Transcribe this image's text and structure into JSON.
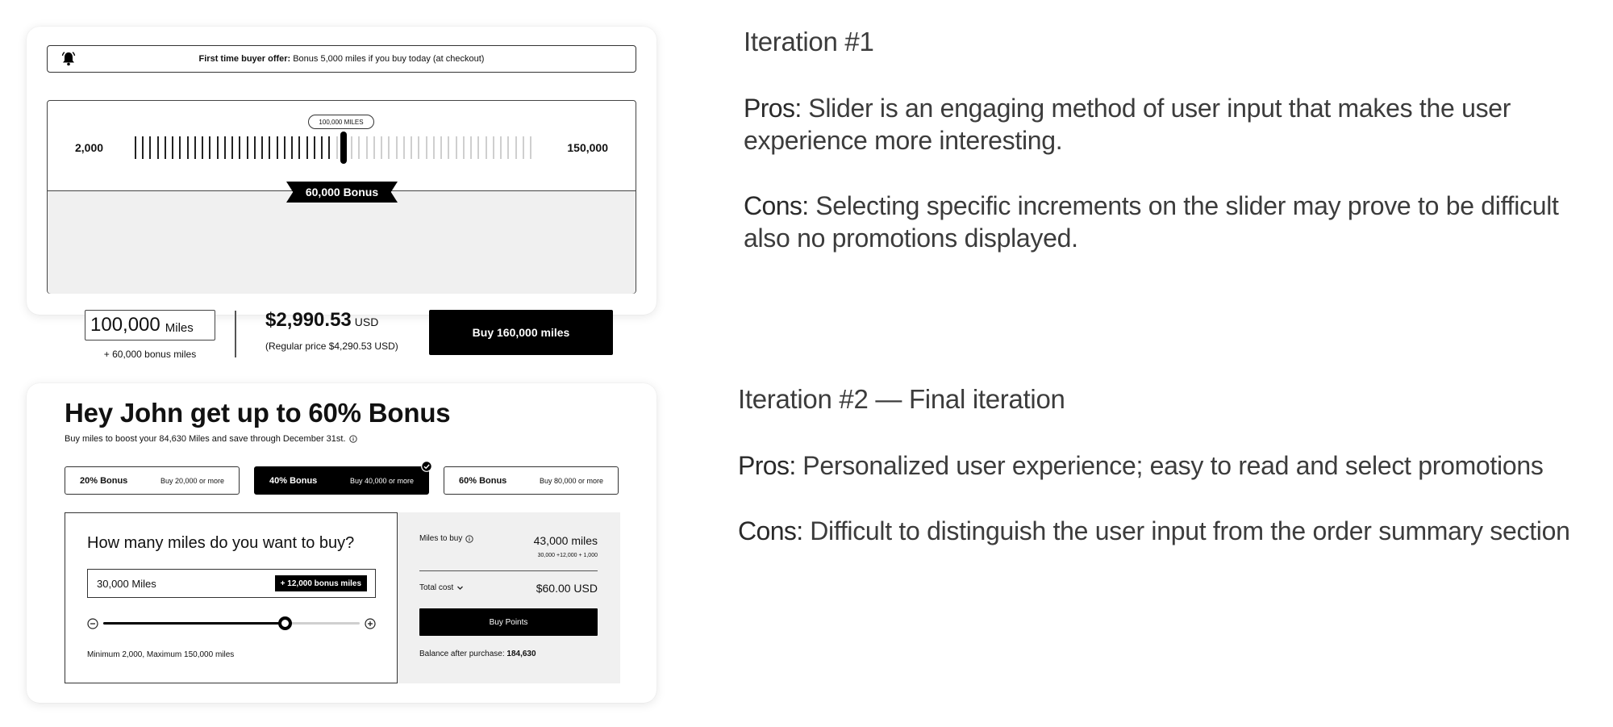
{
  "iteration1": {
    "offer": {
      "bold": "First time buyer offer:",
      "text": "Bonus 5,000 miles if you buy today (at checkout)"
    },
    "slider": {
      "min_label": "2,000",
      "max_label": "150,000",
      "tag": "100,000 MILES",
      "ribbon": "60,000 Bonus",
      "position_fraction": 0.5
    },
    "miles_value": "100,000",
    "miles_unit": "Miles",
    "bonus_note": "+ 60,000 bonus miles",
    "price": "$2,990.53",
    "price_currency": "USD",
    "regular_price": "(Regular price $4,290.53 USD)",
    "buy_label": "Buy 160,000 miles"
  },
  "iteration2": {
    "headline": "Hey John get up to 60% Bonus",
    "subline": "Buy miles to boost your 84,630 Miles and save through December 31st.",
    "tiers": [
      {
        "name": "20% Bonus",
        "desc": "Buy 20,000 or more",
        "selected": false
      },
      {
        "name": "40% Bonus",
        "desc": "Buy 40,000 or more",
        "selected": true
      },
      {
        "name": "60% Bonus",
        "desc": "Buy 80,000 or more",
        "selected": false
      }
    ],
    "question": "How many miles do you want to buy?",
    "input_value": "30,000 Miles",
    "bonus_pill": "+ 12,000 bonus miles",
    "slider_fraction": 0.71,
    "limits": "Minimum 2,000, Maximum 150,000 miles",
    "summary": {
      "miles_label": "Miles to buy",
      "miles_value": "43,000 miles",
      "miles_breakdown": "30,000 +12,000 + 1,000",
      "cost_label": "Total cost",
      "cost_value": "$60.00 USD",
      "buy_label": "Buy Points",
      "balance_label": "Balance after purchase:",
      "balance_value": "184,630"
    }
  },
  "notes": {
    "it1_title": "Iteration #1",
    "it1_pros_label": "Pros:",
    "it1_pros": "Slider is an engaging method of user input that makes the user experience more interesting.",
    "it1_cons_label": "Cons:",
    "it1_cons": "Selecting specific increments on the slider may prove to be difficult also no promotions displayed.",
    "it2_title": "Iteration #2 — Final iteration",
    "it2_pros_label": "Pros:",
    "it2_pros": "Personalized user experience; easy to read and select promotions",
    "it2_cons_label": "Cons:",
    "it2_cons": "Difficult to distinguish the user input from the order summary section"
  }
}
